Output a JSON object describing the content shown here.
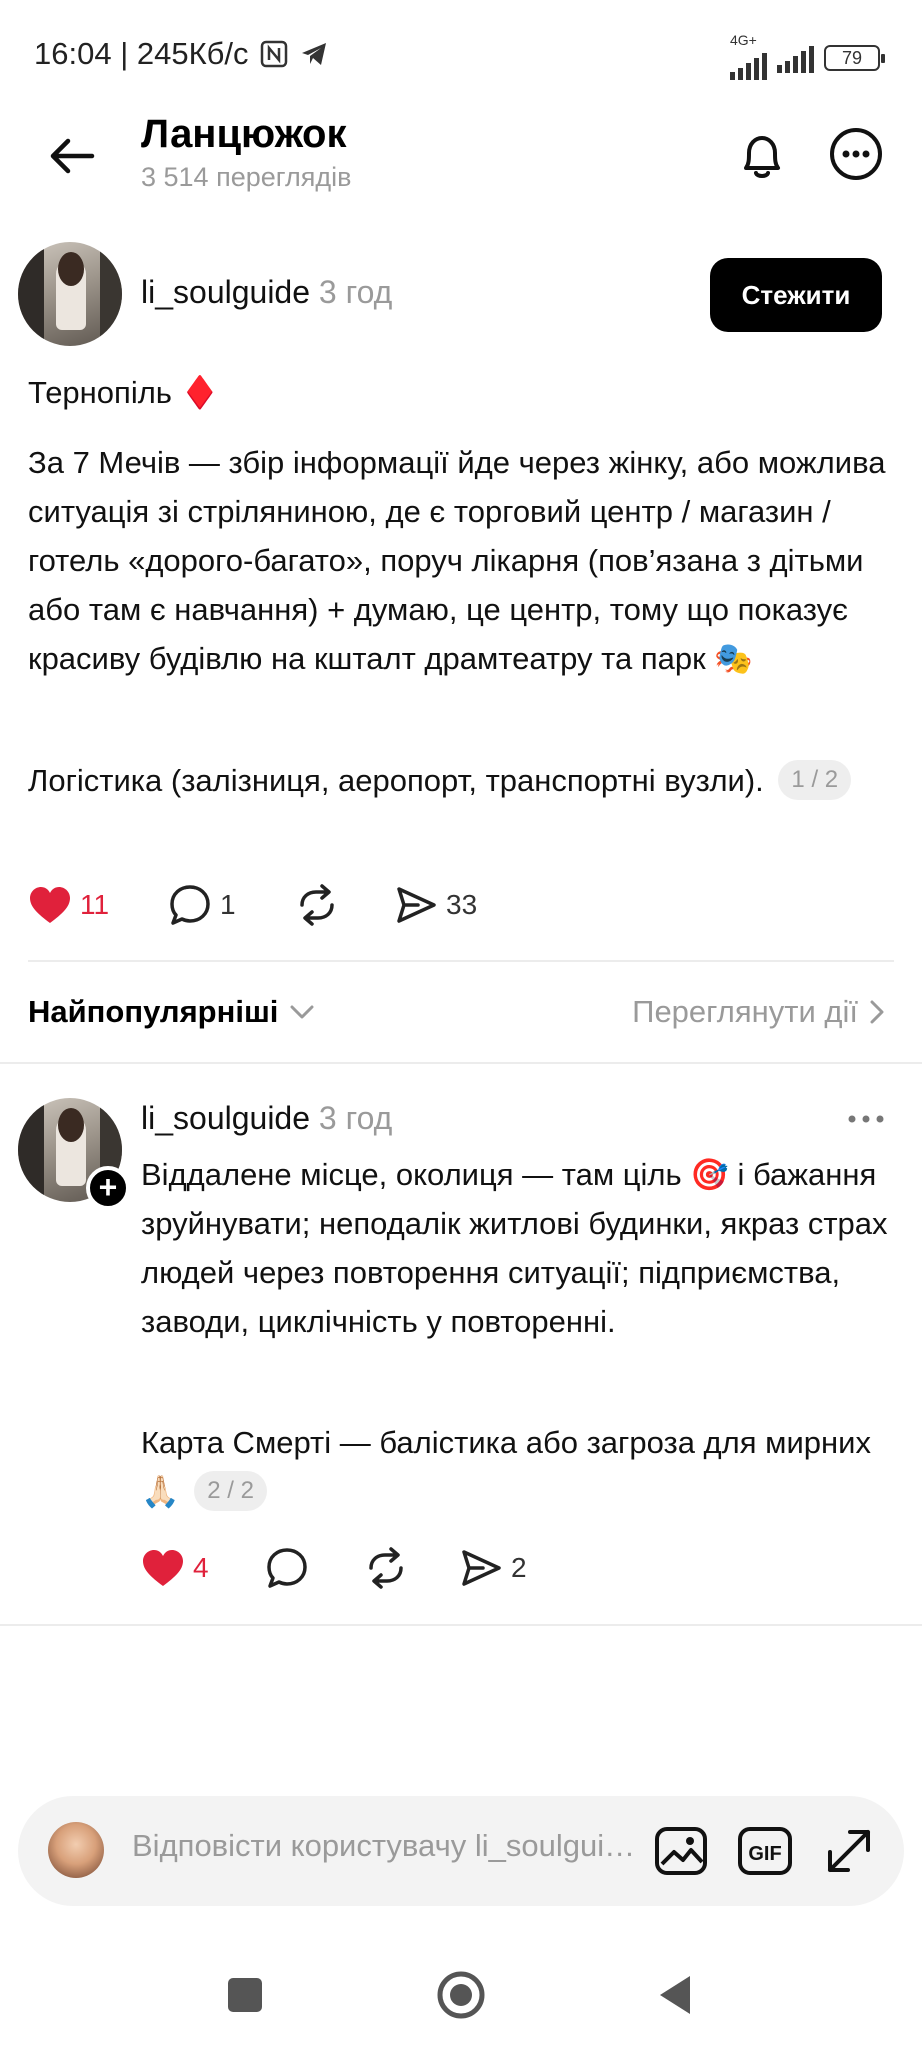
{
  "status_bar": {
    "time_speed": "16:04 | 245Кб/с",
    "network_type": "4G+",
    "battery": "79"
  },
  "header": {
    "title": "Ланцюжок",
    "views": "3 514 переглядів"
  },
  "post": {
    "username": "li_soulguide",
    "time": "3 год",
    "follow_label": "Стежити",
    "paragraph1": "Тернопіль ♦️",
    "paragraph2": "За 7 Мечів — збір інформації йде через жінку, або можлива ситуація зі стріляниною, де є торговий центр / магазин / готель «дорого-багато», поруч лікарня (пов’язана з дітьми або там є навчання) + думаю, це центр, тому що показує красиву будівлю на кшталт драмтеатру та парк 🎭",
    "paragraph3": "Логістика (залізниця, аеропорт, транспортні вузли).",
    "page_badge": "1 / 2",
    "likes": "11",
    "comments": "1",
    "shares": "33"
  },
  "sort": {
    "label": "Найпопулярніші",
    "activity_link": "Переглянути дії"
  },
  "comment": {
    "username": "li_soulguide",
    "time": "3 год",
    "paragraph1": "Віддалене місце, околиця — там ціль 🎯 і бажання зруйнувати; неподалік житлові будинки, якраз страх людей через повторення ситуації; підприємства, заводи, циклічність у повторенні.",
    "paragraph2": "Карта Смерті — балістика або загроза для мирних 🙏🏻",
    "page_badge": "2 / 2",
    "likes": "4",
    "shares": "2"
  },
  "reply": {
    "placeholder": "Відповісти користувачу li_soulguide..."
  },
  "colors": {
    "like_red": "#e0213b",
    "muted_gray": "#9a9a9a",
    "follow_bg": "#000000"
  }
}
